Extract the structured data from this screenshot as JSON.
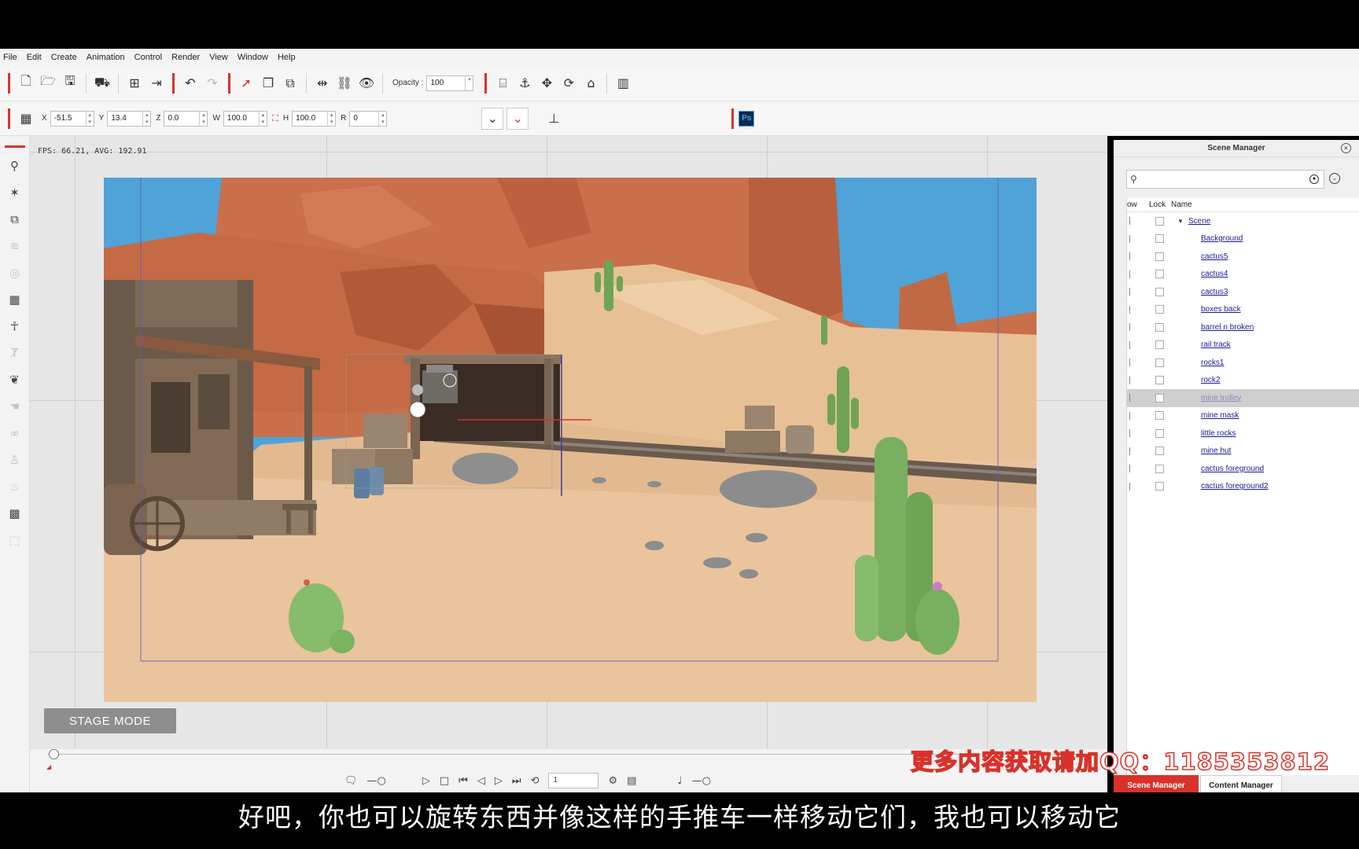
{
  "menu": [
    "File",
    "Edit",
    "Create",
    "Animation",
    "Control",
    "Render",
    "View",
    "Window",
    "Help"
  ],
  "toolbar": {
    "opacity_label": "Opacity :",
    "opacity_value": "100"
  },
  "transform": {
    "x_label": "X",
    "x_value": "-51.5",
    "y_label": "Y",
    "y_value": "13.4",
    "z_label": "Z",
    "z_value": "0.0",
    "w_label": "W",
    "w_value": "100.0",
    "h_label": "H",
    "h_value": "100.0",
    "r_label": "R",
    "r_value": "0",
    "ps_label": "Ps"
  },
  "viewport": {
    "fps_text": "FPS: 66.21, AVG: 192.91",
    "stage_mode": "STAGE MODE"
  },
  "timeline": {
    "frame_value": "1"
  },
  "scene_manager": {
    "title": "Scene Manager",
    "col_show": "ow",
    "col_lock": "Lock",
    "col_name": "Name",
    "items": [
      {
        "name": "Scene",
        "level": 0,
        "selected": false
      },
      {
        "name": "Background",
        "level": 1,
        "selected": false
      },
      {
        "name": "cactus5",
        "level": 1,
        "selected": false
      },
      {
        "name": "cactus4",
        "level": 1,
        "selected": false
      },
      {
        "name": "cactus3",
        "level": 1,
        "selected": false
      },
      {
        "name": "boxes back",
        "level": 1,
        "selected": false
      },
      {
        "name": "barrel n broken",
        "level": 1,
        "selected": false
      },
      {
        "name": "rail track",
        "level": 1,
        "selected": false
      },
      {
        "name": "rocks1",
        "level": 1,
        "selected": false
      },
      {
        "name": "rock2",
        "level": 1,
        "selected": false
      },
      {
        "name": "mine trolley",
        "level": 1,
        "selected": true
      },
      {
        "name": "mine mask",
        "level": 1,
        "selected": false
      },
      {
        "name": "little rocks",
        "level": 1,
        "selected": false
      },
      {
        "name": "mine hut",
        "level": 1,
        "selected": false
      },
      {
        "name": "cactus foreground",
        "level": 1,
        "selected": false
      },
      {
        "name": "cactus foreground2",
        "level": 1,
        "selected": false
      }
    ],
    "tab_scene": "Scene Manager",
    "tab_content": "Content Manager"
  },
  "overlay": {
    "watermark": "更多内容获取请加QQ：1185353812",
    "subtitle": "好吧，你也可以旋转东西并像这样的手推车一样移动它们，我也可以移动它"
  },
  "colors": {
    "accent": "#d8322a",
    "sky": "#4fa3d9",
    "sand": "#e8c096",
    "rock": "#c96f4a"
  }
}
